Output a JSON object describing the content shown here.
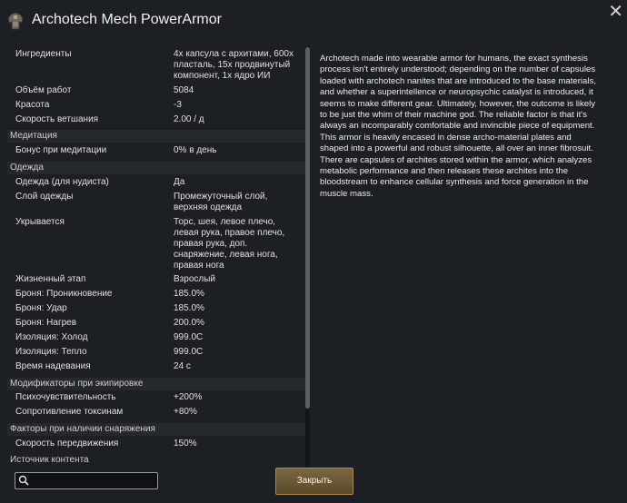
{
  "window": {
    "title": "Archotech Mech PowerArmor",
    "close_symbol": "✕",
    "icon": "armor-icon"
  },
  "stats": {
    "rows": [
      {
        "key": "Ингредиенты",
        "value": "4x капсула с архитами, 600x пласталь, 15x продвинутый компонент, 1x ядро ИИ"
      },
      {
        "key": "Объём работ",
        "value": "5084"
      },
      {
        "key": "Красота",
        "value": "-3"
      },
      {
        "key": "Скорость ветшания",
        "value": "2.00 / д"
      },
      {
        "key": "Бонус при медитации",
        "value": "0% в день"
      },
      {
        "key": "Одежда (для нудиста)",
        "value": "Да"
      },
      {
        "key": "Слой одежды",
        "value": "Промежуточный слой, верхняя одежда"
      },
      {
        "key": "Укрывается",
        "value": "Торс, шея, левое плечо, левая рука, правое плечо, правая рука, доп. снаряжение, левая нога, правая нога"
      },
      {
        "key": "Жизненный этап",
        "value": "Взрослый"
      },
      {
        "key": "Броня: Проникновение",
        "value": "185.0%"
      },
      {
        "key": "Броня: Удар",
        "value": "185.0%"
      },
      {
        "key": "Броня: Нагрев",
        "value": "200.0%"
      },
      {
        "key": "Изоляция: Холод",
        "value": "999.0C"
      },
      {
        "key": "Изоляция: Тепло",
        "value": "999.0C"
      },
      {
        "key": "Время надевания",
        "value": "24 с"
      },
      {
        "key": "Психочувствительность",
        "value": "+200%"
      },
      {
        "key": "Сопротивление токсинам",
        "value": "+80%"
      },
      {
        "key": "Скорость передвижения",
        "value": "150%"
      }
    ],
    "sections": [
      "Медитация",
      "Одежда",
      "Модификаторы при экипировке",
      "Факторы при наличии снаряжения",
      "Источник контента"
    ]
  },
  "description": "Archotech made into wearable armor for humans, the exact synthesis process isn't entirely understood; depending on the number of capsules loaded with archotech nanites that are introduced to the base materials, and whether a superintellence or neuropsychic catalyst is introduced, it seems to make different gear. Ultimately, however, the outcome is likely to be just the whim of their machine god. The reliable factor is that it's always an incomparably comfortable and invincible piece of equipment. This armor is heavily encased in dense archo-material plates and shaped into a powerful and robust silhouette, all over an inner fibrosuit. There are capsules of archites stored within the armor, which analyzes metabolic performance and then releases these archites into the bloodstream to enhance cellular synthesis and force generation in the muscle mass.",
  "search": {
    "value": "",
    "placeholder": ""
  },
  "buttons": {
    "close_label": "Закрыть"
  },
  "colors": {
    "accent": "#b08a45",
    "background": "#1c1f23"
  }
}
